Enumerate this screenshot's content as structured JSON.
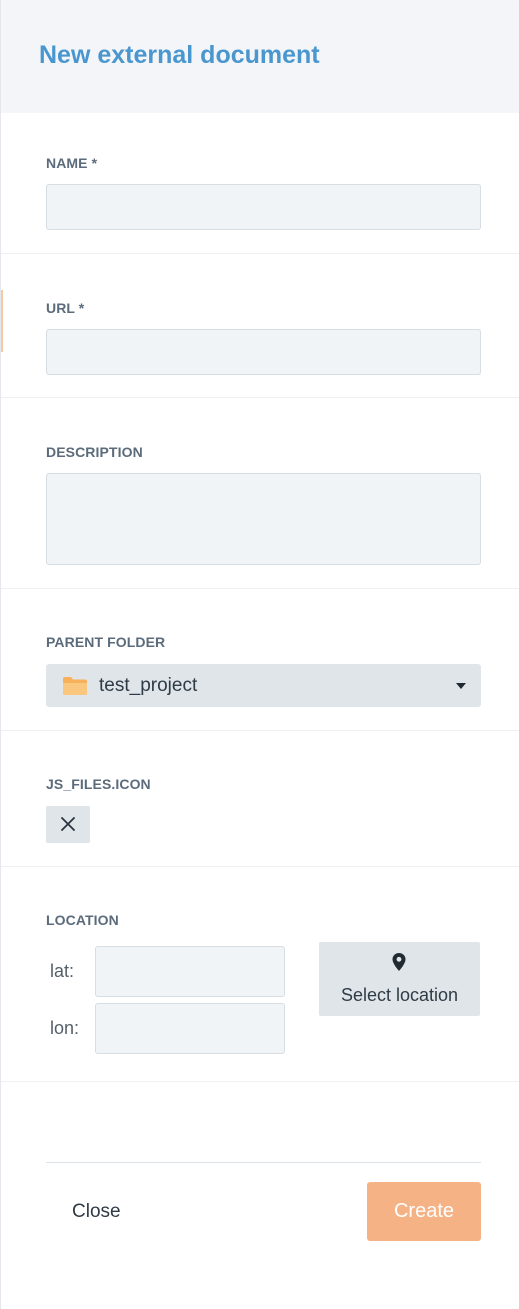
{
  "dialog": {
    "title": "New external document"
  },
  "fields": {
    "name": {
      "label": "NAME *",
      "value": "",
      "placeholder": ""
    },
    "url": {
      "label": "URL *",
      "value": "",
      "placeholder": ""
    },
    "description": {
      "label": "DESCRIPTION",
      "value": "",
      "placeholder": ""
    },
    "parent_folder": {
      "label": "PARENT FOLDER",
      "selected": "test_project",
      "icon": "folder-icon"
    },
    "icon": {
      "label": "JS_FILES.ICON",
      "clear_icon": "close-icon"
    },
    "location": {
      "label": "LOCATION",
      "lat_label": "lat:",
      "lon_label": "lon:",
      "lat_value": "",
      "lon_value": "",
      "select_button_label": "Select location",
      "select_button_icon": "map-pin-icon"
    }
  },
  "footer": {
    "close_label": "Close",
    "create_label": "Create"
  },
  "colors": {
    "title": "#4a97cf",
    "create_button": "#f5b385",
    "folder": "#f6b15a"
  }
}
